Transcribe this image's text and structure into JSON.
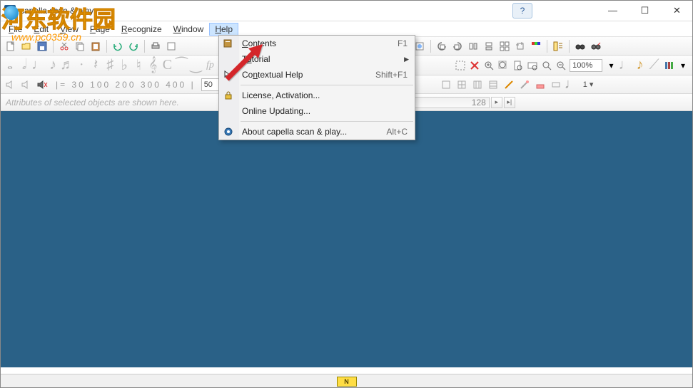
{
  "title": "capella scan & play",
  "menubar": {
    "file": "File",
    "edit": "Edit",
    "view": "View",
    "page": "Page",
    "recognize": "Recognize",
    "window": "Window",
    "help": "Help"
  },
  "help_menu": {
    "contents": "Contents",
    "contents_shortcut": "F1",
    "tutorial": "Tutorial",
    "contextual": "Contextual Help",
    "contextual_shortcut": "Shift+F1",
    "license": "License, Activation...",
    "update": "Online Updating...",
    "about": "About capella scan & play...",
    "about_shortcut": "Alt+C"
  },
  "toolbar3": {
    "ruler_marks": "|= 30  100   200   300   400   |",
    "input_value": "50"
  },
  "status": {
    "attributes": "Attributes of selected objects are shown here.",
    "scroller_value": "128"
  },
  "zoom": {
    "value": "100%"
  },
  "bottom": {
    "indicator": "N"
  },
  "watermark": {
    "cn": "河东软件园",
    "url": "www.pc0359.cn"
  }
}
